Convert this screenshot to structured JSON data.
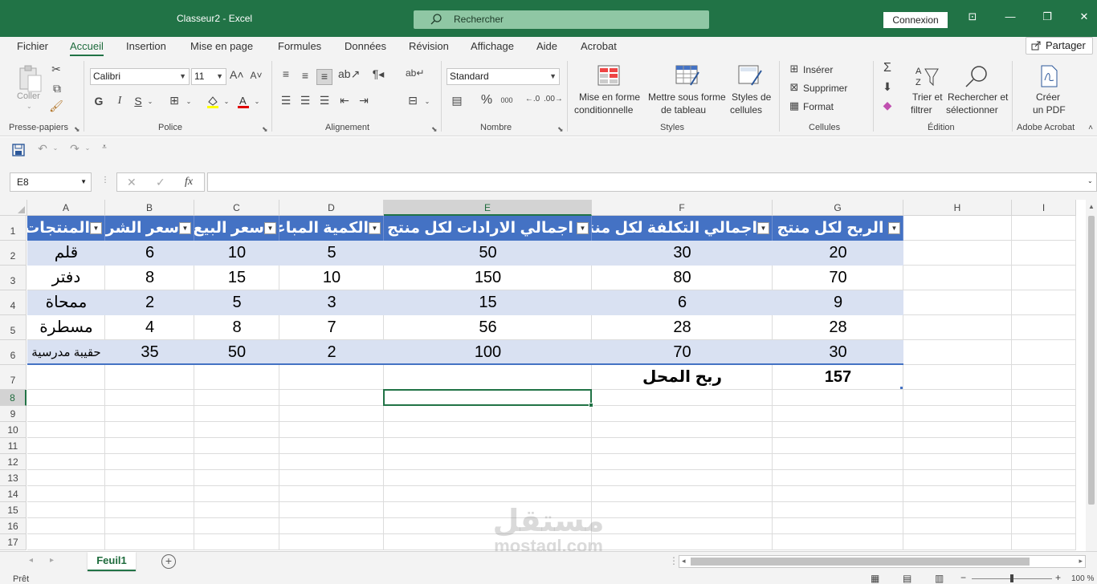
{
  "titlebar": {
    "title": "Classeur2  -  Excel",
    "search_placeholder": "Rechercher",
    "connexion": "Connexion"
  },
  "menu": {
    "tabs": [
      "Fichier",
      "Accueil",
      "Insertion",
      "Mise en page",
      "Formules",
      "Données",
      "Révision",
      "Affichage",
      "Aide",
      "Acrobat"
    ],
    "active": "Accueil",
    "share": "Partager"
  },
  "ribbon": {
    "clipboard": {
      "label": "Presse-papiers",
      "paste": "Coller"
    },
    "font": {
      "label": "Police",
      "name": "Calibri",
      "size": "11",
      "bold": "G",
      "italic": "I",
      "underline": "S"
    },
    "alignment": {
      "label": "Alignement"
    },
    "number": {
      "label": "Nombre",
      "format": "Standard"
    },
    "styles": {
      "label": "Styles",
      "conditional_line1": "Mise en forme",
      "conditional_line2": "conditionnelle",
      "table_line1": "Mettre sous forme",
      "table_line2": "de tableau",
      "cell_line1": "Styles de",
      "cell_line2": "cellules"
    },
    "cells": {
      "label": "Cellules",
      "insert": "Insérer",
      "delete": "Supprimer",
      "format": "Format"
    },
    "editing": {
      "label": "Édition",
      "sort_line1": "Trier et",
      "sort_line2": "filtrer",
      "find_line1": "Rechercher et",
      "find_line2": "sélectionner"
    },
    "acrobat": {
      "label": "Adobe Acrobat",
      "create_line1": "Créer",
      "create_line2": "un PDF"
    }
  },
  "formula_bar": {
    "name_box": "E8",
    "fx": "fx",
    "value": ""
  },
  "sheet": {
    "columns": [
      "A",
      "B",
      "C",
      "D",
      "E",
      "F",
      "G",
      "H",
      "I"
    ],
    "rows": [
      "1",
      "2",
      "3",
      "4",
      "5",
      "6",
      "7",
      "8",
      "9",
      "10",
      "11",
      "12",
      "13",
      "14",
      "15",
      "16",
      "17"
    ],
    "selected_cell": "E8",
    "table_header": [
      "المنتجات",
      "سعر الشراء",
      "سعر البيع",
      "الكمية المباعة",
      "اجمالي الارادات لكل منتج",
      "اجمالي التكلفة لكل منتج",
      "الربح لكل منتج"
    ],
    "table_rows": [
      [
        "قلم",
        "6",
        "10",
        "5",
        "50",
        "30",
        "20"
      ],
      [
        "دفتر",
        "8",
        "15",
        "10",
        "150",
        "80",
        "70"
      ],
      [
        "ممحاة",
        "2",
        "5",
        "3",
        "15",
        "6",
        "9"
      ],
      [
        "مسطرة",
        "4",
        "8",
        "7",
        "56",
        "28",
        "28"
      ],
      [
        "حقيبة مدرسية",
        "35",
        "50",
        "2",
        "100",
        "70",
        "30"
      ]
    ],
    "total_label": "ربح  المحل",
    "total_value": "157"
  },
  "sheet_tabs": [
    "Feuil1"
  ],
  "status": {
    "ready": "Prêt",
    "zoom": "100 %"
  },
  "watermark": {
    "arabic": "مستقل",
    "latin": "mostaql.com"
  },
  "colors": {
    "excel_green": "#217346",
    "table_header": "#4472c4",
    "table_band": "#d9e1f2"
  }
}
